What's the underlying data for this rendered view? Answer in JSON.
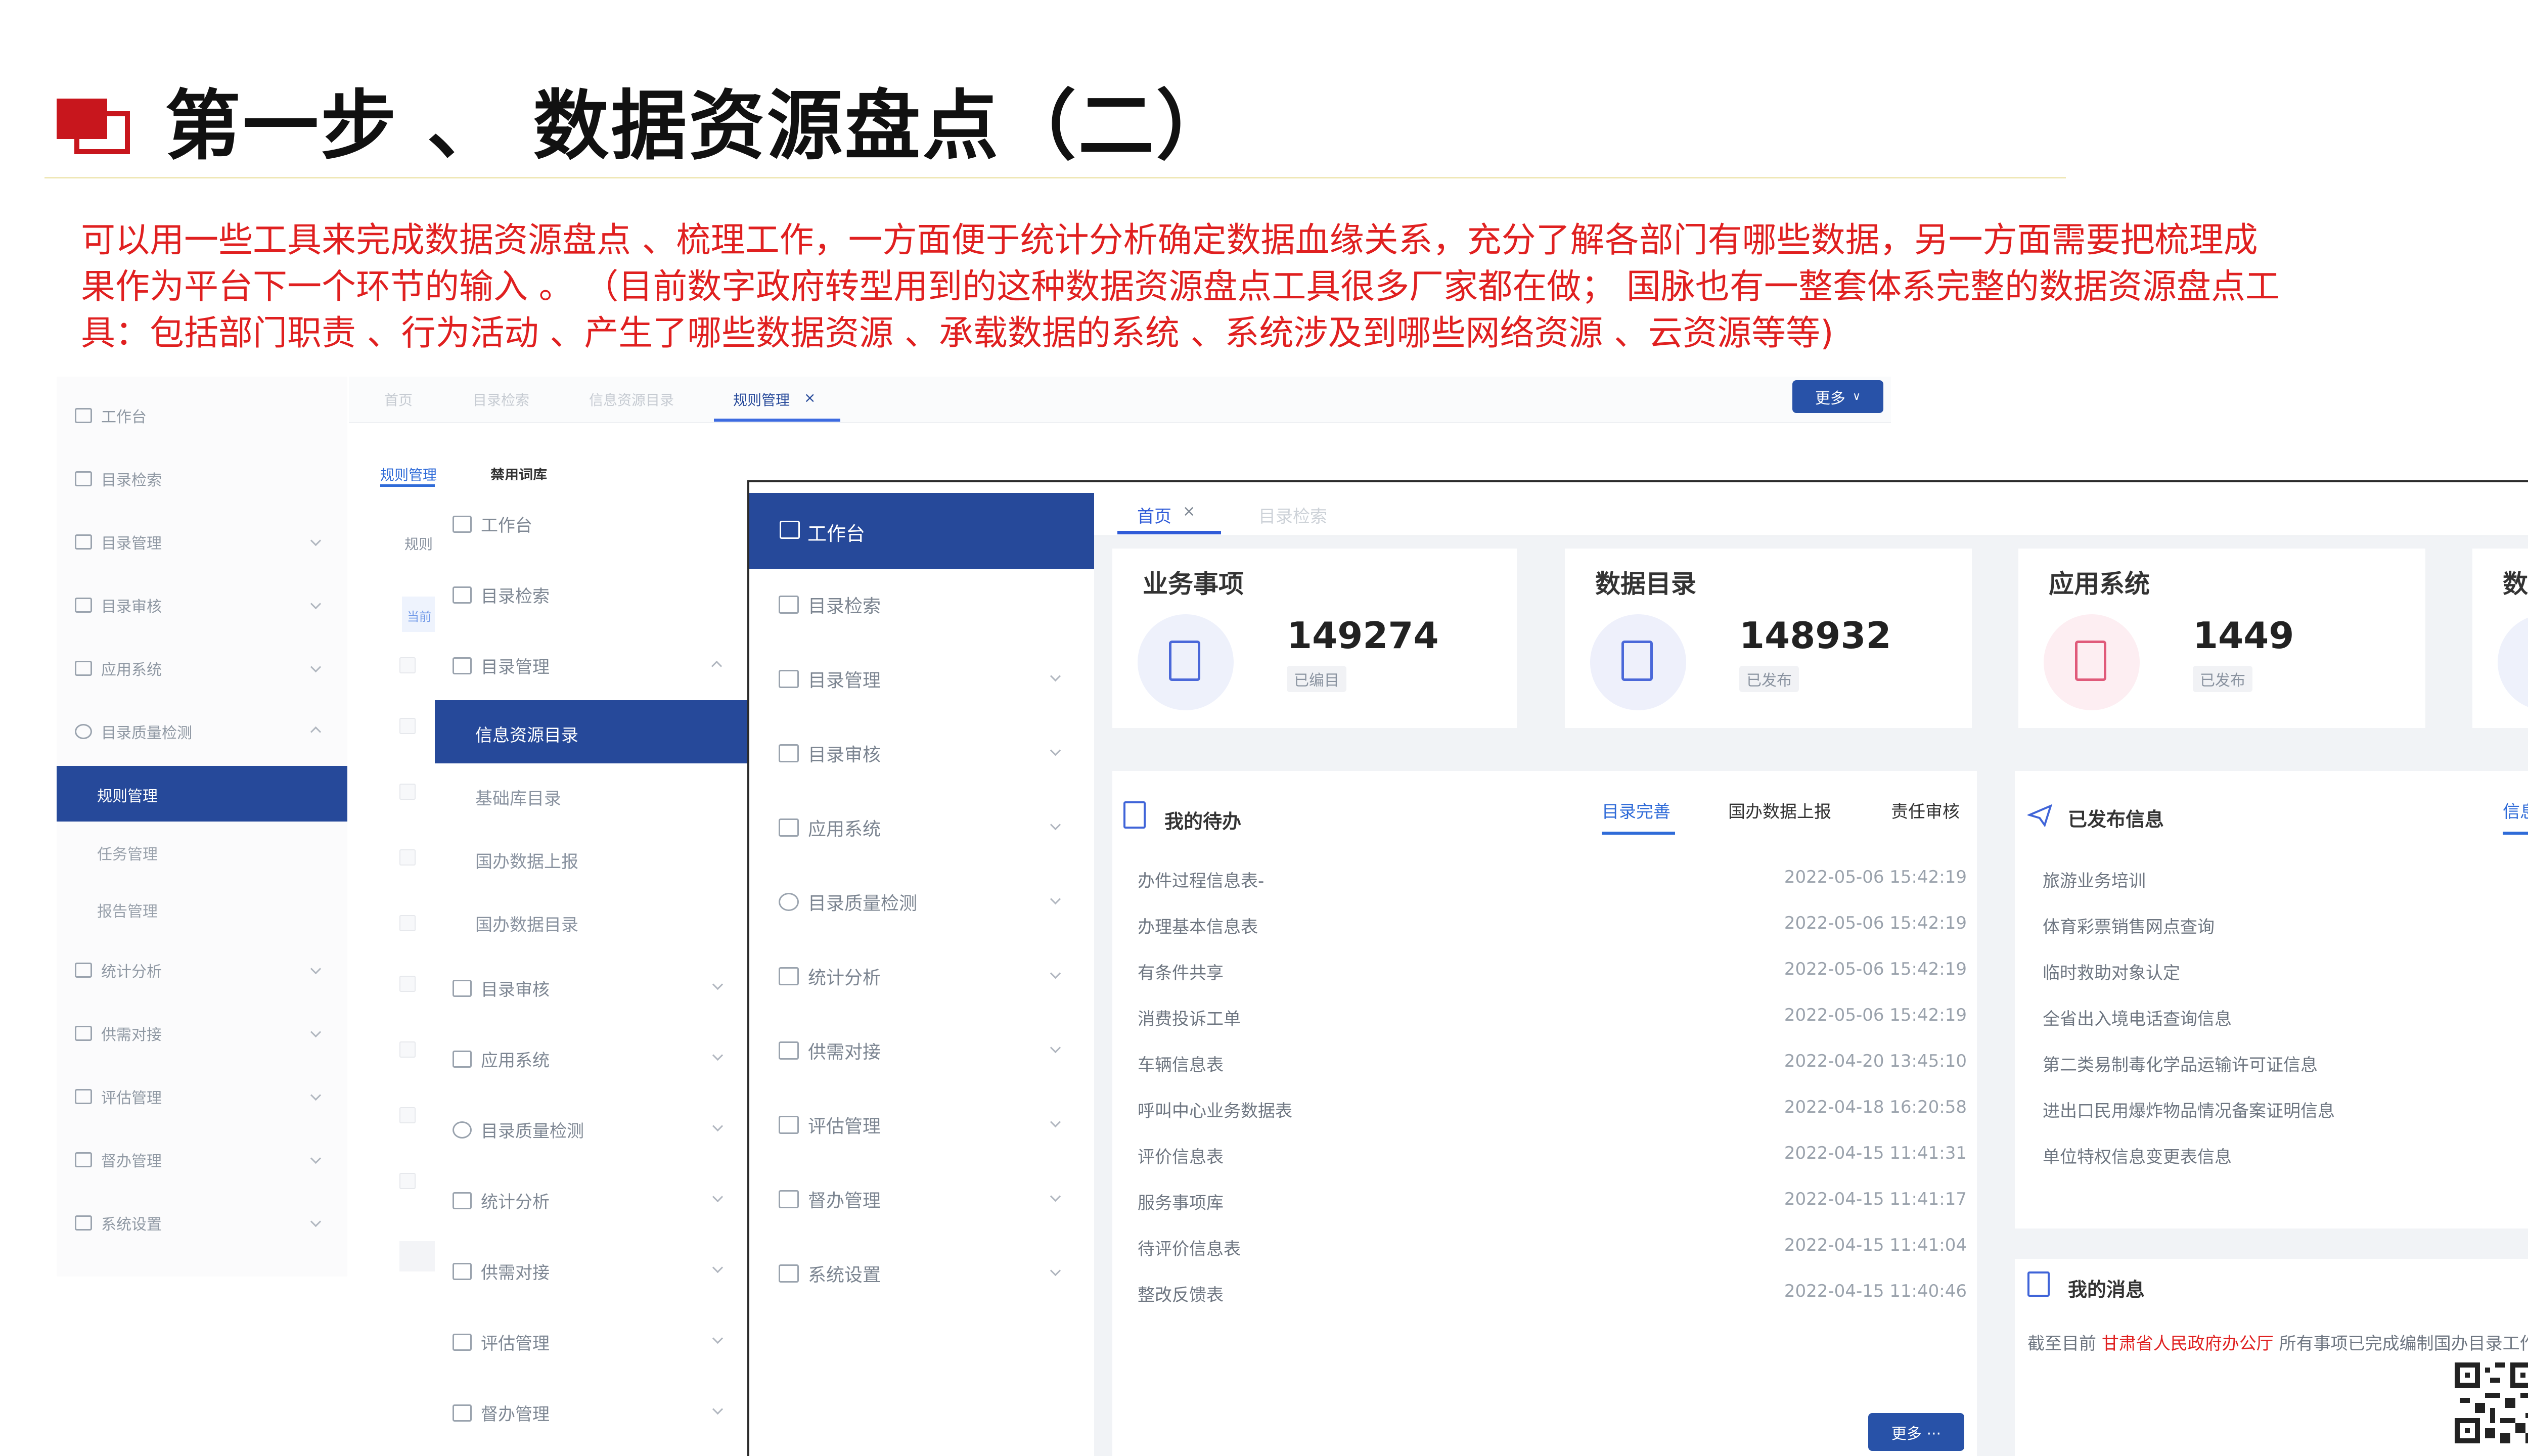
{
  "slide": {
    "title": "第一步 、  数据资源盘点（二）",
    "description": [
      "可以用一些工具来完成数据资源盘点 、梳理工作，一方面便于统计分析确定数据血缘关系，充分了解各部门有哪些数据，另一方面需要把梳理成",
      "果作为平台下一个环节的输入 。 （目前数字政府转型用到的这种数据资源盘点工具很多厂家都在做；  国脉也有一整套体系完整的数据资源盘点工",
      "具：包括部门职责 、行为活动 、产生了哪些数据资源 、承载数据的系统 、系统涉及到哪些网络资源 、云资源等等)"
    ],
    "accent_color": "#e02020"
  },
  "screen1": {
    "nav": [
      "工作台",
      "目录检索",
      "目录管理",
      "目录审核",
      "应用系统",
      "目录质量检测",
      "统计分析",
      "供需对接",
      "评估管理",
      "督办管理",
      "系统设置"
    ],
    "active_sub": "规则管理",
    "subs": [
      "任务管理",
      "报告管理"
    ],
    "tabs": [
      "首页",
      "目录检索",
      "信息资源目录",
      "规则管理"
    ],
    "more_label": "更多",
    "subtabs": [
      "规则管理",
      "禁用词库"
    ],
    "frag1": "规则",
    "frag2": "当前"
  },
  "screen2": {
    "nav_top": [
      "工作台",
      "目录检索",
      "目录管理"
    ],
    "active_sub": "信息资源目录",
    "subs": [
      "基础库目录",
      "国办数据上报",
      "国办数据目录"
    ],
    "nav_bottom": [
      "目录审核",
      "应用系统",
      "目录质量检测",
      "统计分析",
      "供需对接",
      "评估管理",
      "督办管理"
    ]
  },
  "screen3": {
    "active_nav": "工作台",
    "nav": [
      "目录检索",
      "目录管理",
      "目录审核",
      "应用系统",
      "目录质量检测",
      "统计分析",
      "供需对接",
      "评估管理",
      "督办管理",
      "系统设置"
    ],
    "tabs": [
      "首页",
      "目录检索"
    ],
    "cards": [
      {
        "title": "业务事项",
        "value": "149274",
        "badge": "已编目",
        "color": "#4a68d9",
        "bg": "#eef1fb"
      },
      {
        "title": "数据目录",
        "value": "148932",
        "badge": "已发布",
        "color": "#3f55c8",
        "bg": "#eef0fb"
      },
      {
        "title": "应用系统",
        "value": "1449",
        "badge": "已发布",
        "color": "#e05a7a",
        "bg": "#fdeef2"
      },
      {
        "title": "数据需求",
        "value": "",
        "badge": "",
        "color": "#4a68d9",
        "bg": "#eef1fb"
      }
    ],
    "todo": {
      "title": "我的待办",
      "tabs": [
        "目录完善",
        "国办数据上报",
        "责任审核"
      ],
      "rows": [
        {
          "name": "办件过程信息表-",
          "date": "2022-05-06 15:42:19"
        },
        {
          "name": "办理基本信息表",
          "date": "2022-05-06 15:42:19"
        },
        {
          "name": "有条件共享",
          "date": "2022-05-06 15:42:19"
        },
        {
          "name": "消费投诉工单",
          "date": "2022-05-06 15:42:19"
        },
        {
          "name": "车辆信息表",
          "date": "2022-04-20 13:45:10"
        },
        {
          "name": "呼叫中心业务数据表",
          "date": "2022-04-18 16:20:58"
        },
        {
          "name": "评价信息表",
          "date": "2022-04-15 11:41:31"
        },
        {
          "name": "服务事项库",
          "date": "2022-04-15 11:41:17"
        },
        {
          "name": "待评价信息表",
          "date": "2022-04-15 11:41:04"
        },
        {
          "name": "整改反馈表",
          "date": "2022-04-15 11:40:46"
        }
      ],
      "more_label": "更多 ···"
    },
    "published": {
      "title": "已发布信息",
      "tab": "信息资源目",
      "items": [
        "旅游业务培训",
        "体育彩票销售网点查询",
        "临时救助对象认定",
        "全省出入境电话查询信息",
        "第二类易制毒化学品运输许可证信息",
        "进出口民用爆炸物品情况备案证明信息",
        "单位特权信息变更表信息"
      ]
    },
    "message": {
      "title": "我的消息",
      "prefix": "截至目前 ",
      "org": "甘肃省人民政府办公厅",
      "suffix": " 所有事项已完成编制国办目录工作。"
    }
  }
}
